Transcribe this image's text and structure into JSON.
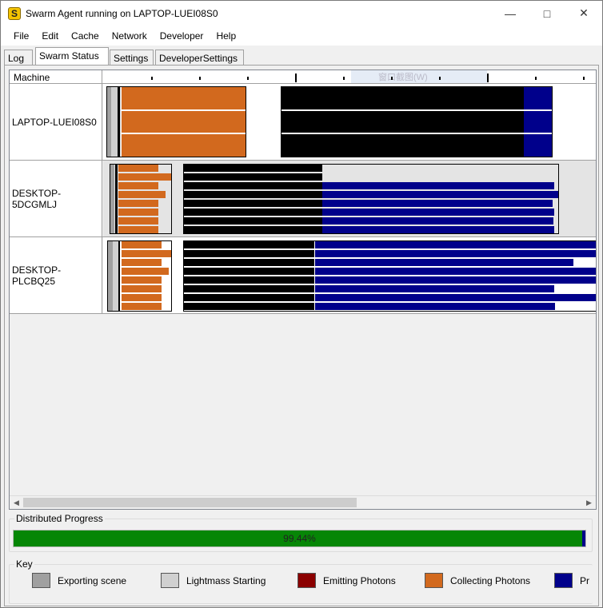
{
  "window": {
    "title": "Swarm Agent running on LAPTOP-LUEI08S0",
    "icon": "swarm-s-icon",
    "controls": [
      "minimize-icon",
      "maximize-icon",
      "close-icon"
    ]
  },
  "menu": [
    "File",
    "Edit",
    "Cache",
    "Network",
    "Developer",
    "Help"
  ],
  "tabs": [
    {
      "label": "Log",
      "active": false
    },
    {
      "label": "Swarm Status",
      "active": true
    },
    {
      "label": "Settings",
      "active": false
    },
    {
      "label": "DeveloperSettings",
      "active": false
    }
  ],
  "grid": {
    "machine_header": "Machine",
    "overlay_text": "窗口截图(W)",
    "machines": [
      {
        "name": "LAPTOP-LUEI08S0"
      },
      {
        "name": "DESKTOP-5DCGMLJ"
      },
      {
        "name": "DESKTOP-PLCBQ25"
      }
    ]
  },
  "progress": {
    "group_title": "Distributed Progress",
    "percent_text": "99.44%",
    "percent": 99.44,
    "fill_color": "#068606"
  },
  "key": {
    "group_title": "Key",
    "items": [
      {
        "label": "Exporting scene",
        "color": "#a0a0a0"
      },
      {
        "label": "Lightmass Starting",
        "color": "#d0d0d0"
      },
      {
        "label": "Emitting Photons",
        "color": "#8b0000"
      },
      {
        "label": "Collecting Photons",
        "color": "#d2691e"
      },
      {
        "label": "Pr",
        "color": "#00008b"
      }
    ]
  },
  "colors": {
    "exporting": "#a0a0a0",
    "lightmass": "#d0d0d0",
    "emitting": "#8b0000",
    "collecting": "#d2691e",
    "processing": "#00008b",
    "progress": "#068606"
  }
}
